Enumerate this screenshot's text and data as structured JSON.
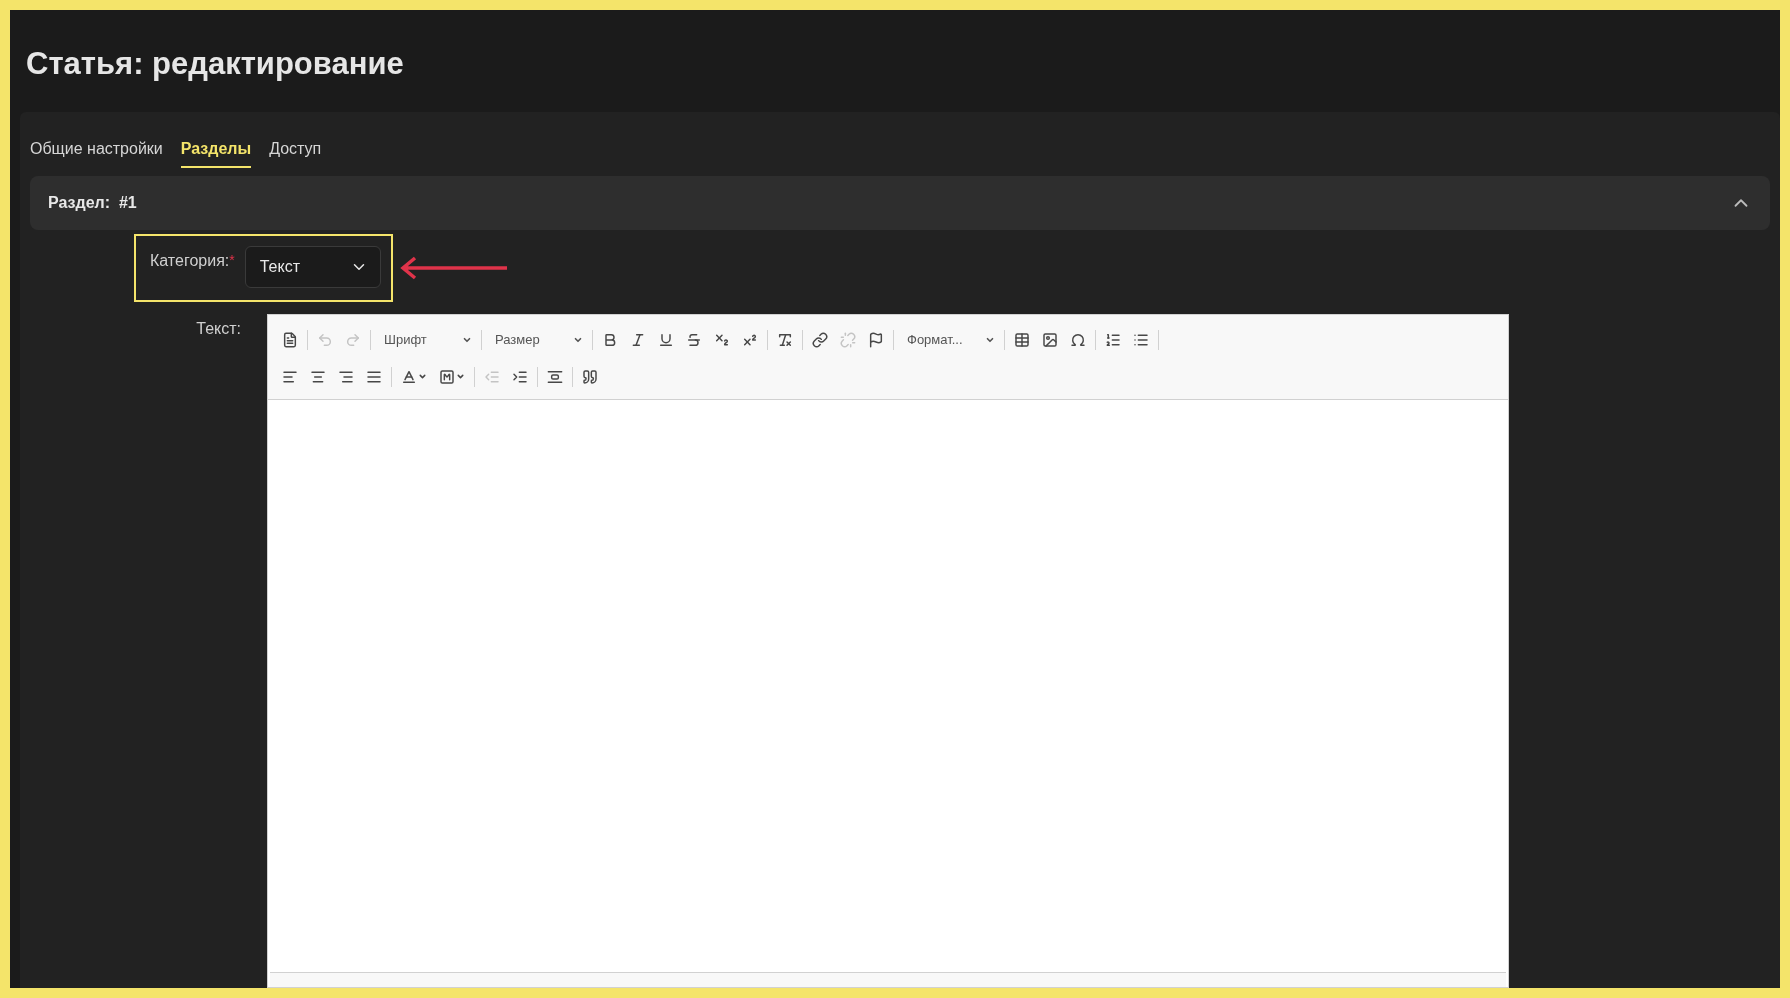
{
  "page": {
    "title": "Статья: редактирование"
  },
  "tabs": [
    {
      "label": "Общие настройки",
      "selected": false
    },
    {
      "label": "Разделы",
      "selected": true
    },
    {
      "label": "Доступ",
      "selected": false
    }
  ],
  "section": {
    "title": "Раздел:  #1",
    "expanded": true
  },
  "category": {
    "label": "Категория:",
    "required": "*",
    "value": "Текст",
    "highlighted": true
  },
  "editor": {
    "label": "Текст:",
    "toolbar_rows": [
      [
        {
          "kind": "button",
          "disabled": false
        },
        {
          "kind": "separator"
        },
        {
          "kind": "button",
          "disabled": true
        },
        {
          "kind": "button",
          "disabled": true
        },
        {
          "kind": "separator"
        },
        {
          "kind": "combo",
          "label": "Шрифт"
        },
        {
          "kind": "separator"
        },
        {
          "kind": "combo",
          "label": "Размер"
        },
        {
          "kind": "separator"
        },
        {
          "kind": "button",
          "disabled": false
        },
        {
          "kind": "button",
          "disabled": false
        },
        {
          "kind": "button",
          "disabled": false
        },
        {
          "kind": "button",
          "disabled": false
        },
        {
          "kind": "button",
          "disabled": false
        },
        {
          "kind": "button",
          "disabled": false
        },
        {
          "kind": "separator"
        },
        {
          "kind": "button",
          "disabled": false
        },
        {
          "kind": "separator"
        },
        {
          "kind": "button",
          "disabled": false
        },
        {
          "kind": "button",
          "disabled": true
        },
        {
          "kind": "button",
          "disabled": false
        },
        {
          "kind": "separator"
        },
        {
          "kind": "combo",
          "label": "Формат..."
        },
        {
          "kind": "separator"
        },
        {
          "kind": "button",
          "disabled": false
        },
        {
          "kind": "button",
          "disabled": false
        },
        {
          "kind": "button",
          "disabled": false
        },
        {
          "kind": "separator"
        },
        {
          "kind": "button",
          "disabled": false
        },
        {
          "kind": "button",
          "disabled": false
        },
        {
          "kind": "separator"
        }
      ],
      [
        {
          "kind": "button",
          "disabled": false
        },
        {
          "kind": "button",
          "disabled": false
        },
        {
          "kind": "button",
          "disabled": false
        },
        {
          "kind": "button",
          "disabled": false
        },
        {
          "kind": "separator"
        },
        {
          "kind": "menu-button",
          "disabled": false
        },
        {
          "kind": "menu-button",
          "disabled": false
        },
        {
          "kind": "separator"
        },
        {
          "kind": "button",
          "disabled": true
        },
        {
          "kind": "button",
          "disabled": false
        },
        {
          "kind": "separator"
        },
        {
          "kind": "button",
          "disabled": false
        },
        {
          "kind": "separator"
        },
        {
          "kind": "button",
          "disabled": false
        }
      ]
    ]
  }
}
